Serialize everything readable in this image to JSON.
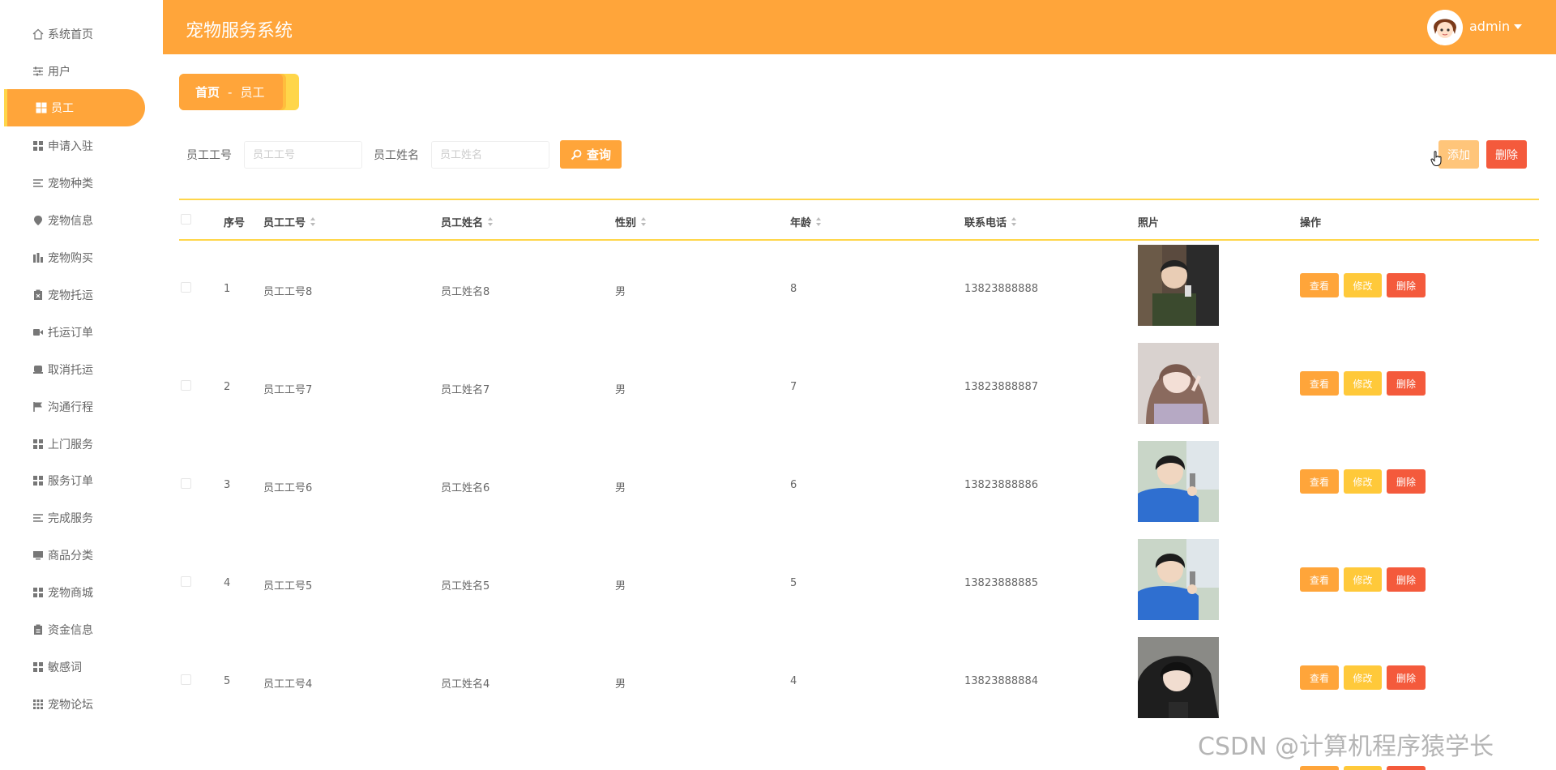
{
  "app": {
    "title": "宠物服务系统",
    "user_name": "admin"
  },
  "sidebar": {
    "items": [
      {
        "label": "系统首页",
        "icon": "home-icon"
      },
      {
        "label": "用户",
        "icon": "sliders-icon"
      },
      {
        "label": "员工",
        "icon": "grid-icon",
        "active": true
      },
      {
        "label": "申请入驻",
        "icon": "grid-icon"
      },
      {
        "label": "宠物种类",
        "icon": "list-icon"
      },
      {
        "label": "宠物信息",
        "icon": "pin-icon"
      },
      {
        "label": "宠物购买",
        "icon": "chart-icon"
      },
      {
        "label": "宠物托运",
        "icon": "clipboard-icon"
      },
      {
        "label": "托运订单",
        "icon": "video-icon"
      },
      {
        "label": "取消托运",
        "icon": "box-icon"
      },
      {
        "label": "沟通行程",
        "icon": "flag-icon"
      },
      {
        "label": "上门服务",
        "icon": "grid-icon"
      },
      {
        "label": "服务订单",
        "icon": "grid-icon"
      },
      {
        "label": "完成服务",
        "icon": "list-icon"
      },
      {
        "label": "商品分类",
        "icon": "monitor-icon"
      },
      {
        "label": "宠物商城",
        "icon": "grid-icon"
      },
      {
        "label": "资金信息",
        "icon": "clipboard-icon"
      },
      {
        "label": "敏感词",
        "icon": "grid-icon"
      },
      {
        "label": "宠物论坛",
        "icon": "apps-icon"
      }
    ]
  },
  "breadcrumb": {
    "home": "首页",
    "separator": "-",
    "current": "员工"
  },
  "search": {
    "employee_no_label": "员工工号",
    "employee_no_placeholder": "员工工号",
    "employee_name_label": "员工姓名",
    "employee_name_placeholder": "员工姓名",
    "query_label": "查询"
  },
  "toolbar": {
    "add_label": "添加",
    "delete_label": "删除"
  },
  "table": {
    "columns": [
      "序号",
      "员工工号",
      "员工姓名",
      "性别",
      "年龄",
      "联系电话",
      "照片",
      "操作"
    ],
    "rows": [
      {
        "index": "1",
        "no": "员工工号8",
        "name": "员工姓名8",
        "gender": "男",
        "age": "8",
        "phone": "13823888888"
      },
      {
        "index": "2",
        "no": "员工工号7",
        "name": "员工姓名7",
        "gender": "男",
        "age": "7",
        "phone": "13823888887"
      },
      {
        "index": "3",
        "no": "员工工号6",
        "name": "员工姓名6",
        "gender": "男",
        "age": "6",
        "phone": "13823888886"
      },
      {
        "index": "4",
        "no": "员工工号5",
        "name": "员工姓名5",
        "gender": "男",
        "age": "5",
        "phone": "13823888885"
      },
      {
        "index": "5",
        "no": "员工工号4",
        "name": "员工姓名4",
        "gender": "男",
        "age": "4",
        "phone": "13823888884"
      }
    ],
    "actions": {
      "view": "查看",
      "edit": "修改",
      "delete": "删除"
    }
  },
  "watermark": "CSDN @计算机程序猿学长"
}
